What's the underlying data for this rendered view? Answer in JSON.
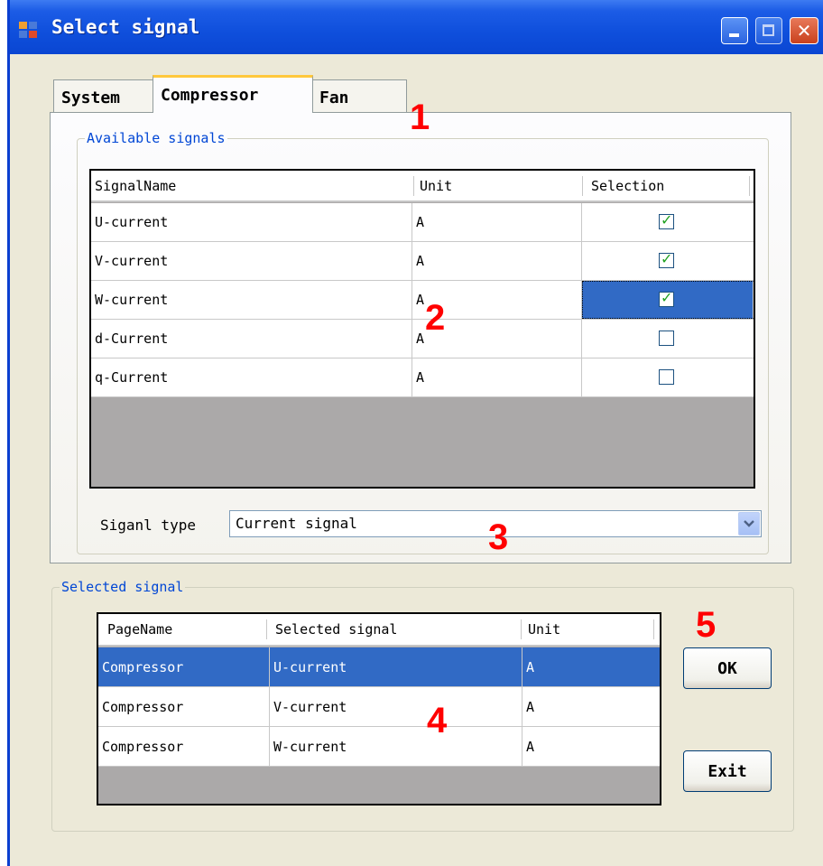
{
  "window": {
    "title": "Select signal"
  },
  "tabs": [
    {
      "label": "System",
      "active": false
    },
    {
      "label": "Compressor",
      "active": true
    },
    {
      "label": "Fan",
      "active": false
    }
  ],
  "available": {
    "legend": "Available signals",
    "columns": [
      "SignalName",
      "Unit",
      "Selection"
    ],
    "rows": [
      {
        "name": "U-current",
        "unit": "A",
        "checked": true
      },
      {
        "name": "V-current",
        "unit": "A",
        "checked": true
      },
      {
        "name": "W-current",
        "unit": "A",
        "checked": true
      },
      {
        "name": "d-Current",
        "unit": "A",
        "checked": false
      },
      {
        "name": "q-Current",
        "unit": "A",
        "checked": false
      }
    ]
  },
  "signal_type": {
    "label": "Siganl type",
    "value": "Current signal"
  },
  "selected": {
    "legend": "Selected signal",
    "columns": [
      "PageName",
      "Selected signal",
      "Unit"
    ],
    "rows": [
      {
        "page": "Compressor",
        "signal": "U-current",
        "unit": "A"
      },
      {
        "page": "Compressor",
        "signal": "V-current",
        "unit": "A"
      },
      {
        "page": "Compressor",
        "signal": "W-current",
        "unit": "A"
      }
    ]
  },
  "buttons": {
    "ok": "OK",
    "exit": "Exit"
  },
  "markers": [
    "1",
    "2",
    "3",
    "4",
    "5"
  ],
  "colors": {
    "titlebar": "#0a46d2",
    "selection": "#316ac5",
    "marker": "#ff0000",
    "tab_highlight": "#ffc83c"
  }
}
